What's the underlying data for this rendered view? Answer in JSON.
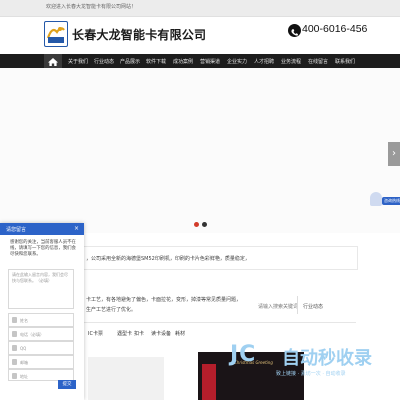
{
  "topbar": {
    "welcome": "欢迎进入长春大龙智能卡有限公司网站！"
  },
  "header": {
    "company_name": "长春大龙智能卡有限公司",
    "phone_icon": "phone-icon",
    "phone": "400-6016-456"
  },
  "nav": {
    "home_icon": "home-icon",
    "items": [
      {
        "label": "关于我们"
      },
      {
        "label": "行业动态"
      },
      {
        "label": "产品展示"
      },
      {
        "label": "软件下载"
      },
      {
        "label": "成功案例"
      },
      {
        "label": "营销渠道"
      },
      {
        "label": "企业实力"
      },
      {
        "label": "人才招聘"
      },
      {
        "label": "业务流程"
      },
      {
        "label": "在线留言"
      },
      {
        "label": "联系我们"
      }
    ]
  },
  "banner": {
    "next_arrow": "›"
  },
  "consult": {
    "label": "咨询热线"
  },
  "content": {
    "intro_text": "，公司采用全新的海德堡SM52印刷机，印刷的卡片色彩鲜艳，质量稳定，",
    "process_text": "卡工艺，有各地避免了偏色，卡面拉花，变形，掉漆等常见质量问题，",
    "process_text_2": "生产工艺进行了优化。",
    "search_placeholder": "请输入搜索关键词",
    "trends": "行业动态",
    "tags": [
      "IC卡票",
      "遇型卡",
      "扣卡",
      "读卡设备",
      "耗材"
    ]
  },
  "product": {
    "caption": "Christmas Greeting"
  },
  "watermark": {
    "logo": "JC",
    "title": "自动秒收录",
    "sub": "致上链接 · 素坊一次 · 自动收录"
  },
  "message": {
    "title": "请您留言",
    "close": "×",
    "intro": "感谢您的关注，当前客服人员不在线，请填写一下您的信息，我们会尽快和您联系。",
    "textarea_placeholder": "请在此输入留言内容，我们会尽快与您联系。（必填）",
    "fields": [
      {
        "placeholder": "姓名"
      },
      {
        "placeholder": "电话（必填）"
      },
      {
        "placeholder": "QQ"
      },
      {
        "placeholder": "邮箱"
      },
      {
        "placeholder": "地址"
      }
    ],
    "submit": "提交"
  }
}
